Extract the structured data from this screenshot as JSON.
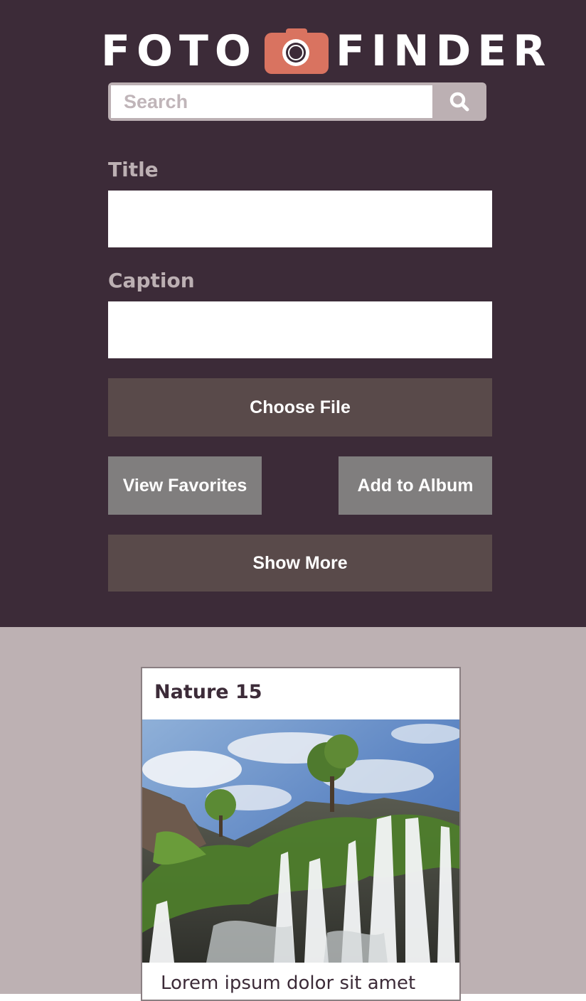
{
  "logo": {
    "word_left": "FOTO",
    "word_right": "FINDER",
    "icon": "camera-icon"
  },
  "search": {
    "placeholder": "Search",
    "value": "",
    "button_icon": "search-icon"
  },
  "form": {
    "title_label": "Title",
    "title_value": "",
    "caption_label": "Caption",
    "caption_value": "",
    "choose_file_label": "Choose File",
    "view_favorites_label": "View Favorites",
    "add_to_album_label": "Add to Album",
    "show_more_label": "Show More"
  },
  "gallery": {
    "cards": [
      {
        "title": "Nature 15",
        "image": "waterfall-photo",
        "caption": "Lorem ipsum dolor sit amet"
      }
    ]
  },
  "colors": {
    "header_bg": "#3c2b38",
    "gallery_bg": "#bdb1b3",
    "camera_accent": "#d97360",
    "button_dark": "#594a4a",
    "button_gray": "#807e7e",
    "label_text": "#bcb0b3"
  }
}
